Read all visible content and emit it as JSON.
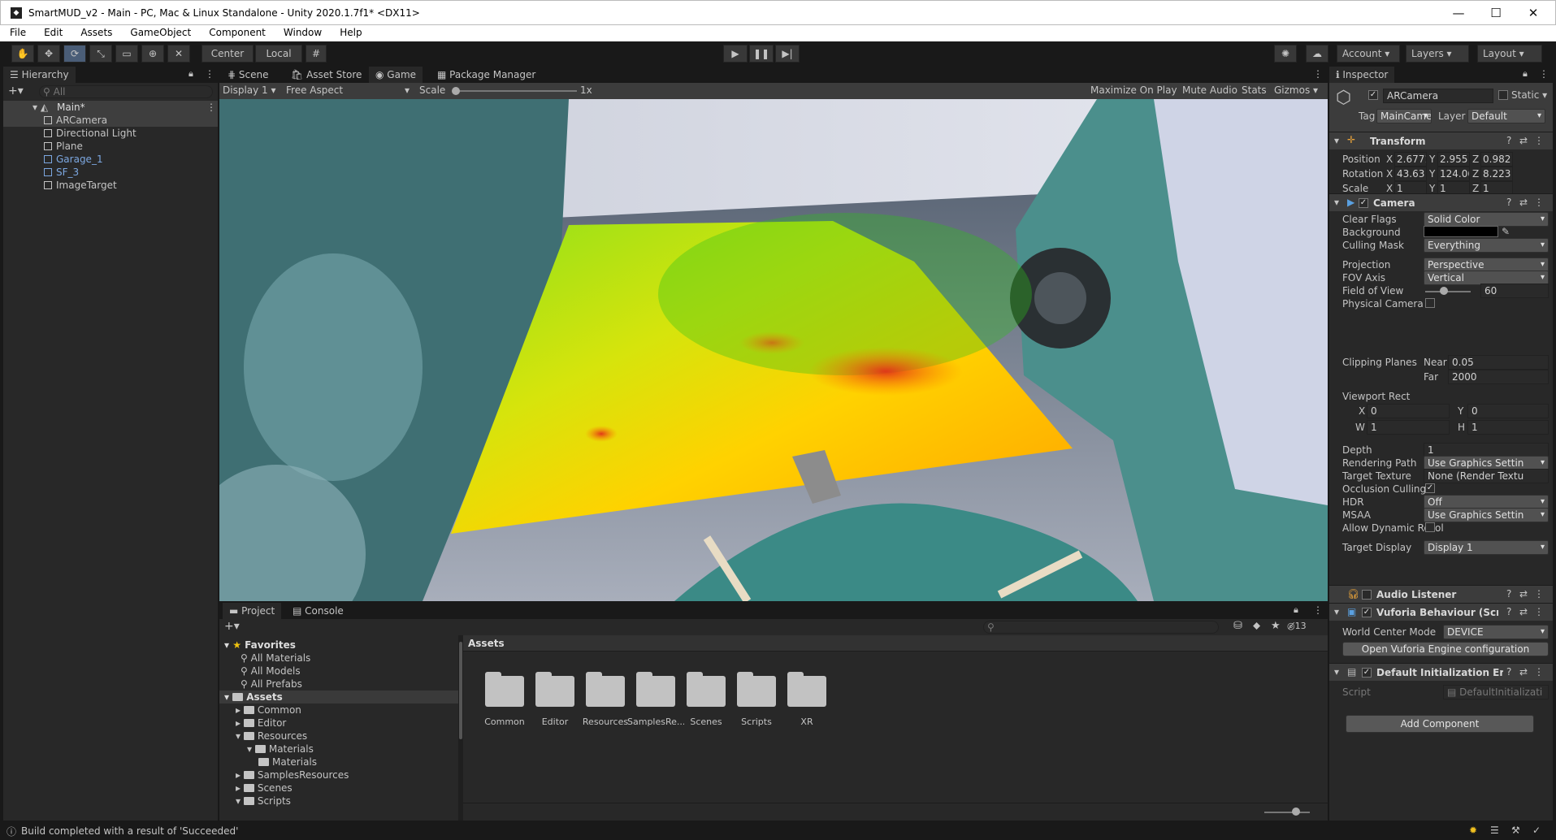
{
  "window": {
    "title": "SmartMUD_v2 - Main - PC, Mac & Linux Standalone - Unity 2020.1.7f1* <DX11>",
    "minimize": "—",
    "maximize": "☐",
    "close": "✕"
  },
  "menu": [
    "File",
    "Edit",
    "Assets",
    "GameObject",
    "Component",
    "Window",
    "Help"
  ],
  "toolbar": {
    "center": "Center",
    "local": "Local",
    "account": "Account",
    "layers": "Layers",
    "layout": "Layout"
  },
  "hierarchy": {
    "tab": "Hierarchy",
    "search_placeholder": "All",
    "scene": "Main*",
    "items": [
      {
        "label": "ARCamera",
        "prefab": false
      },
      {
        "label": "Directional Light",
        "prefab": false
      },
      {
        "label": "Plane",
        "prefab": false
      },
      {
        "label": "Garage_1",
        "prefab": true
      },
      {
        "label": "SF_3",
        "prefab": true
      },
      {
        "label": "ImageTarget",
        "prefab": false
      }
    ]
  },
  "center_tabs": {
    "scene": "Scene",
    "asset_store": "Asset Store",
    "game": "Game",
    "package_manager": "Package Manager"
  },
  "game_bar": {
    "display": "Display 1",
    "aspect": "Free Aspect",
    "scale_label": "Scale",
    "scale_value": "1x",
    "maximize": "Maximize On Play",
    "mute": "Mute Audio",
    "stats": "Stats",
    "gizmos": "Gizmos"
  },
  "project": {
    "tab_project": "Project",
    "tab_console": "Console",
    "hidden_count": "13",
    "favorites": "Favorites",
    "fav_items": [
      "All Materials",
      "All Models",
      "All Prefabs"
    ],
    "assets_root": "Assets",
    "tree": [
      {
        "label": "Common",
        "depth": 1,
        "expanded": false
      },
      {
        "label": "Editor",
        "depth": 1,
        "expanded": false
      },
      {
        "label": "Resources",
        "depth": 1,
        "expanded": true
      },
      {
        "label": "Materials",
        "depth": 2,
        "expanded": true
      },
      {
        "label": "Materials",
        "depth": 3,
        "expanded": false
      },
      {
        "label": "SamplesResources",
        "depth": 1,
        "expanded": false
      },
      {
        "label": "Scenes",
        "depth": 1,
        "expanded": false
      },
      {
        "label": "Scripts",
        "depth": 1,
        "expanded": true
      }
    ],
    "breadcrumb": "Assets",
    "folders": [
      "Common",
      "Editor",
      "Resources",
      "SamplesRe...",
      "Scenes",
      "Scripts",
      "XR"
    ]
  },
  "inspector": {
    "tab": "Inspector",
    "object_name": "ARCamera",
    "static": "Static",
    "tag_label": "Tag",
    "tag_value": "MainCame",
    "layer_label": "Layer",
    "layer_value": "Default",
    "transform": {
      "title": "Transform",
      "position_label": "Position",
      "rotation_label": "Rotation",
      "scale_label": "Scale",
      "position": [
        "2.67715",
        "2.955",
        "0.982"
      ],
      "rotation": [
        "43.63",
        "124.064",
        "8.223"
      ],
      "scale": [
        "1",
        "1",
        "1"
      ]
    },
    "camera": {
      "title": "Camera",
      "rows": [
        {
          "label": "Clear Flags",
          "value": "Solid Color",
          "kind": "drop"
        },
        {
          "label": "Background",
          "value": "",
          "kind": "color"
        },
        {
          "label": "Culling Mask",
          "value": "Everything",
          "kind": "drop"
        },
        {
          "label": "Projection",
          "value": "Perspective",
          "kind": "drop"
        },
        {
          "label": "FOV Axis",
          "value": "Vertical",
          "kind": "drop"
        },
        {
          "label": "Field of View",
          "value": "60",
          "kind": "slider"
        },
        {
          "label": "Physical Camera",
          "value": "",
          "kind": "check"
        }
      ],
      "clipping_label": "Clipping Planes",
      "near_label": "Near",
      "near": "0.05",
      "far_label": "Far",
      "far": "2000",
      "viewport_label": "Viewport Rect",
      "vx": "0",
      "vy": "0",
      "vw": "1",
      "vh": "1",
      "rows2": [
        {
          "label": "Depth",
          "value": "1",
          "kind": "field"
        },
        {
          "label": "Rendering Path",
          "value": "Use Graphics Settin",
          "kind": "drop"
        },
        {
          "label": "Target Texture",
          "value": "None (Render Textu",
          "kind": "field"
        },
        {
          "label": "Occlusion Culling",
          "value": "✓",
          "kind": "check"
        },
        {
          "label": "HDR",
          "value": "Off",
          "kind": "drop"
        },
        {
          "label": "MSAA",
          "value": "Use Graphics Settin",
          "kind": "drop"
        },
        {
          "label": "Allow Dynamic Resol",
          "value": "",
          "kind": "check"
        },
        {
          "label": "Target Display",
          "value": "Display 1",
          "kind": "drop"
        }
      ]
    },
    "audio_listener": "Audio Listener",
    "vuforia": "Vuforia Behaviour (Script)",
    "world_center_label": "World Center Mode",
    "world_center_value": "DEVICE",
    "open_vuforia": "Open Vuforia Engine configuration",
    "default_init": "Default Initialization Error",
    "script_label": "Script",
    "script_value": "DefaultInitializati",
    "add_component": "Add Component"
  },
  "status": {
    "message": "Build completed with a result of 'Succeeded'"
  }
}
